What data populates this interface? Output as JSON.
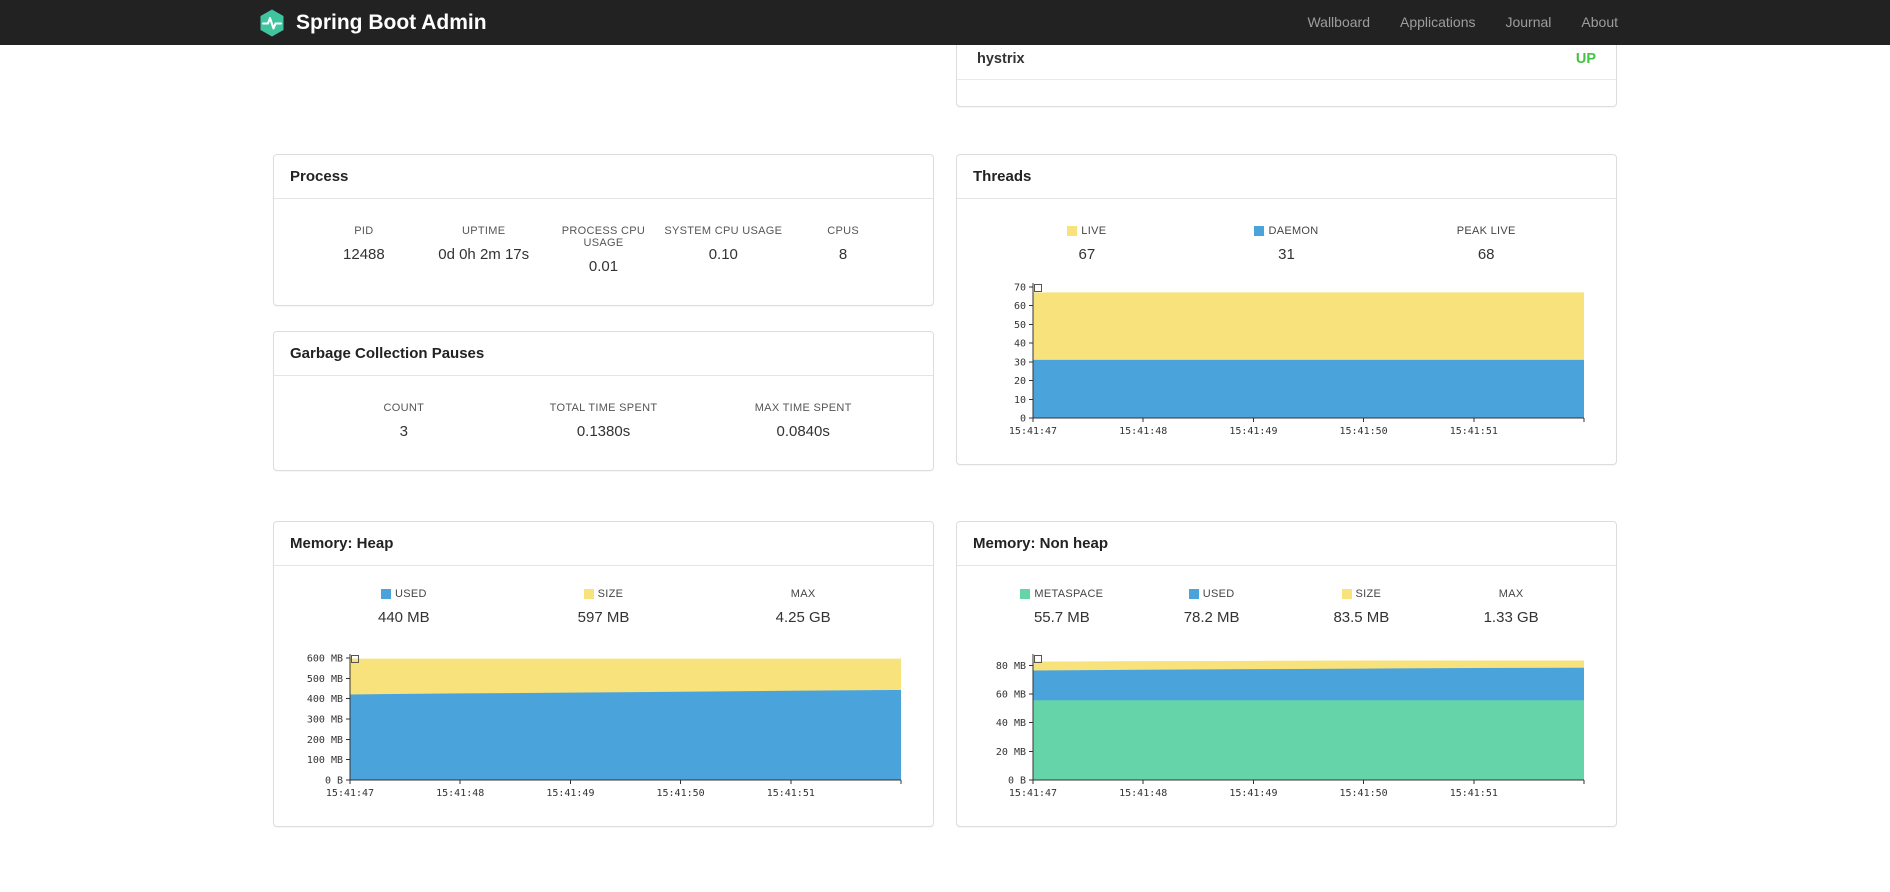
{
  "navbar": {
    "brand": "Spring Boot Admin",
    "links": [
      {
        "label": "Wallboard"
      },
      {
        "label": "Applications"
      },
      {
        "label": "Journal"
      },
      {
        "label": "About"
      }
    ]
  },
  "applications_panel": {
    "rows": [
      {
        "name": "hystrix",
        "status": "UP",
        "status_color": "#44c244"
      }
    ]
  },
  "process": {
    "title": "Process",
    "metrics": [
      {
        "label": "PID",
        "value": "12488"
      },
      {
        "label": "UPTIME",
        "value": "0d 0h 2m 17s"
      },
      {
        "label": "PROCESS CPU USAGE",
        "value": "0.01"
      },
      {
        "label": "SYSTEM CPU USAGE",
        "value": "0.10"
      },
      {
        "label": "CPUS",
        "value": "8"
      }
    ]
  },
  "gc": {
    "title": "Garbage Collection Pauses",
    "metrics": [
      {
        "label": "COUNT",
        "value": "3"
      },
      {
        "label": "TOTAL TIME SPENT",
        "value": "0.1380s"
      },
      {
        "label": "MAX TIME SPENT",
        "value": "0.0840s"
      }
    ]
  },
  "threads": {
    "title": "Threads",
    "legend": [
      {
        "label": "LIVE",
        "color": "#f8e27c",
        "value": "67"
      },
      {
        "label": "DAEMON",
        "color": "#4ba3dc",
        "value": "31"
      },
      {
        "label": "PEAK LIVE",
        "color": "",
        "value": "68"
      }
    ]
  },
  "heap": {
    "title": "Memory: Heap",
    "legend": [
      {
        "label": "USED",
        "color": "#4ba3dc",
        "value": "440 MB"
      },
      {
        "label": "SIZE",
        "color": "#f8e27c",
        "value": "597 MB"
      },
      {
        "label": "MAX",
        "color": "",
        "value": "4.25 GB"
      }
    ]
  },
  "nonheap": {
    "title": "Memory: Non heap",
    "legend": [
      {
        "label": "METASPACE",
        "color": "#65d5a9",
        "value": "55.7 MB"
      },
      {
        "label": "USED",
        "color": "#4ba3dc",
        "value": "78.2 MB"
      },
      {
        "label": "SIZE",
        "color": "#f8e27c",
        "value": "83.5 MB"
      },
      {
        "label": "MAX",
        "color": "",
        "value": "1.33 GB"
      }
    ]
  },
  "colors": {
    "accent_teal": "#40c4a0",
    "status_up": "#44c244",
    "series_yellow": "#f8e27c",
    "series_blue": "#4ba3dc",
    "series_green": "#65d5a9",
    "axis": "#333333"
  },
  "chart_data": [
    {
      "id": "threads",
      "type": "area",
      "title": "Threads",
      "xlabel": "",
      "ylabel": "",
      "ylim": [
        0,
        72
      ],
      "grid": false,
      "legend_position": "top",
      "x_ticks": [
        "15:41:47",
        "15:41:48",
        "15:41:49",
        "15:41:50",
        "15:41:51"
      ],
      "y_ticks": [
        {
          "v": 0,
          "label": "0"
        },
        {
          "v": 10,
          "label": "10"
        },
        {
          "v": 20,
          "label": "20"
        },
        {
          "v": 30,
          "label": "30"
        },
        {
          "v": 40,
          "label": "40"
        },
        {
          "v": 50,
          "label": "50"
        },
        {
          "v": 60,
          "label": "60"
        },
        {
          "v": 70,
          "label": "70"
        }
      ],
      "series": [
        {
          "name": "LIVE",
          "color": "#f8e27c",
          "values": [
            67,
            67,
            67,
            67,
            67,
            67
          ]
        },
        {
          "name": "DAEMON",
          "color": "#4ba3dc",
          "values": [
            31,
            31,
            31,
            31,
            31,
            31
          ]
        }
      ],
      "annotations": {
        "peak_live": 68
      }
    },
    {
      "id": "heap",
      "type": "area",
      "title": "Memory: Heap",
      "xlabel": "",
      "ylabel": "",
      "ylim": [
        0,
        620
      ],
      "grid": false,
      "legend_position": "top",
      "x_ticks": [
        "15:41:47",
        "15:41:48",
        "15:41:49",
        "15:41:50",
        "15:41:51"
      ],
      "y_ticks": [
        {
          "v": 0,
          "label": "0 B"
        },
        {
          "v": 100,
          "label": "100 MB"
        },
        {
          "v": 200,
          "label": "200 MB"
        },
        {
          "v": 300,
          "label": "300 MB"
        },
        {
          "v": 400,
          "label": "400 MB"
        },
        {
          "v": 500,
          "label": "500 MB"
        },
        {
          "v": 600,
          "label": "600 MB"
        }
      ],
      "series": [
        {
          "name": "SIZE",
          "color": "#f8e27c",
          "values": [
            597,
            597,
            597,
            597,
            597,
            597
          ]
        },
        {
          "name": "USED",
          "color": "#4ba3dc",
          "values": [
            421,
            426,
            430,
            434,
            439,
            443
          ]
        }
      ],
      "annotations": {
        "max": "4.25 GB"
      }
    },
    {
      "id": "nonheap",
      "type": "area",
      "title": "Memory: Non heap",
      "xlabel": "",
      "ylabel": "",
      "ylim": [
        0,
        88
      ],
      "grid": false,
      "legend_position": "top",
      "x_ticks": [
        "15:41:47",
        "15:41:48",
        "15:41:49",
        "15:41:50",
        "15:41:51"
      ],
      "y_ticks": [
        {
          "v": 0,
          "label": "0 B"
        },
        {
          "v": 20,
          "label": "20 MB"
        },
        {
          "v": 40,
          "label": "40 MB"
        },
        {
          "v": 60,
          "label": "60 MB"
        },
        {
          "v": 80,
          "label": "80 MB"
        }
      ],
      "series": [
        {
          "name": "SIZE",
          "color": "#f8e27c",
          "values": [
            82.7,
            83.0,
            83.2,
            83.5,
            83.5,
            83.5
          ]
        },
        {
          "name": "USED",
          "color": "#4ba3dc",
          "values": [
            76.5,
            77.0,
            77.4,
            77.8,
            78.2,
            78.4
          ]
        },
        {
          "name": "METASPACE",
          "color": "#65d5a9",
          "values": [
            55.7,
            55.7,
            55.7,
            55.7,
            55.7,
            55.7
          ]
        }
      ],
      "annotations": {
        "max": "1.33 GB"
      }
    }
  ]
}
